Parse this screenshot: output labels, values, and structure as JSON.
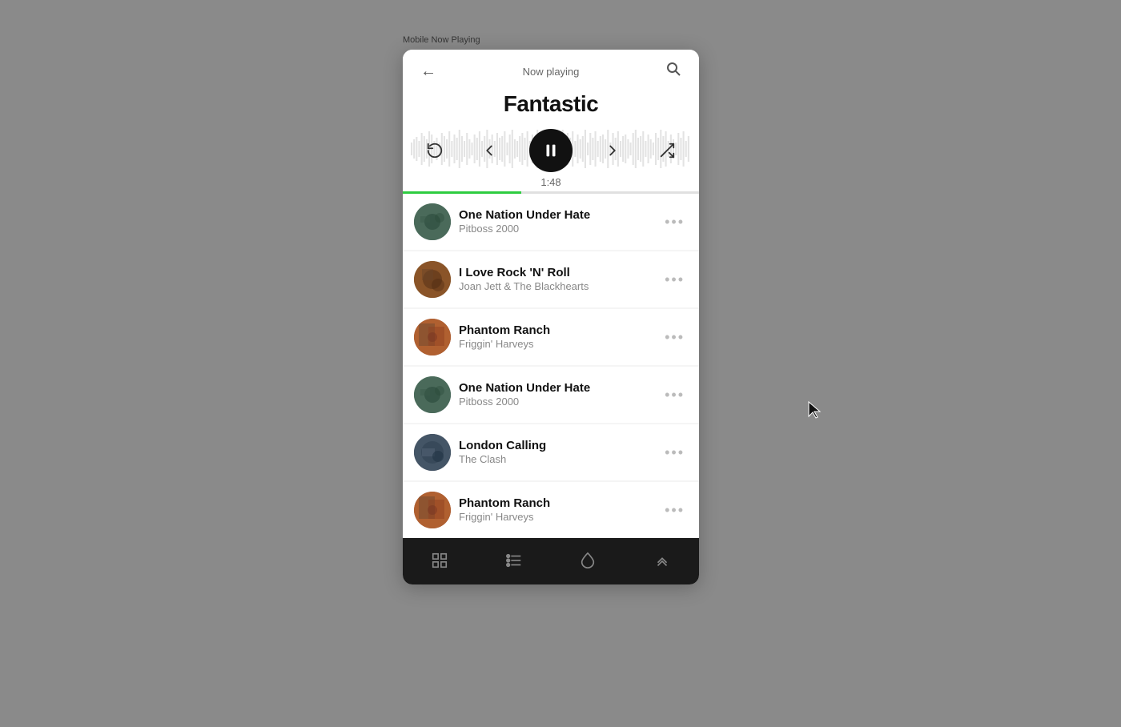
{
  "window": {
    "label": "Mobile Now Playing",
    "title": "Now playing"
  },
  "player": {
    "track_title": "Fantastic",
    "time": "1:48",
    "progress_percent": 40
  },
  "controls": {
    "back_label": "←",
    "search_label": "🔍",
    "replay_label": "↺",
    "prev_label": "←",
    "pause_label": "⏸",
    "next_label": "→",
    "shuffle_label": "⇌"
  },
  "tracks": [
    {
      "id": 1,
      "name": "One Nation Under Hate",
      "artist": "Pitboss 2000",
      "art_class": "art-1"
    },
    {
      "id": 2,
      "name": "I Love Rock 'N' Roll",
      "artist": "Joan Jett & The Blackhearts",
      "art_class": "art-2"
    },
    {
      "id": 3,
      "name": "Phantom Ranch",
      "artist": "Friggin' Harveys",
      "art_class": "art-3"
    },
    {
      "id": 4,
      "name": "One Nation Under Hate",
      "artist": "Pitboss 2000",
      "art_class": "art-4"
    },
    {
      "id": 5,
      "name": "London Calling",
      "artist": "The Clash",
      "art_class": "art-5"
    },
    {
      "id": 6,
      "name": "Phantom Ranch",
      "artist": "Friggin' Harveys",
      "art_class": "art-6"
    }
  ],
  "bottom_nav": {
    "items": [
      {
        "icon": "⊞",
        "name": "grid-nav"
      },
      {
        "icon": "≡",
        "name": "list-nav"
      },
      {
        "icon": "◇",
        "name": "home-nav"
      },
      {
        "icon": "⋀",
        "name": "up-nav"
      }
    ]
  }
}
